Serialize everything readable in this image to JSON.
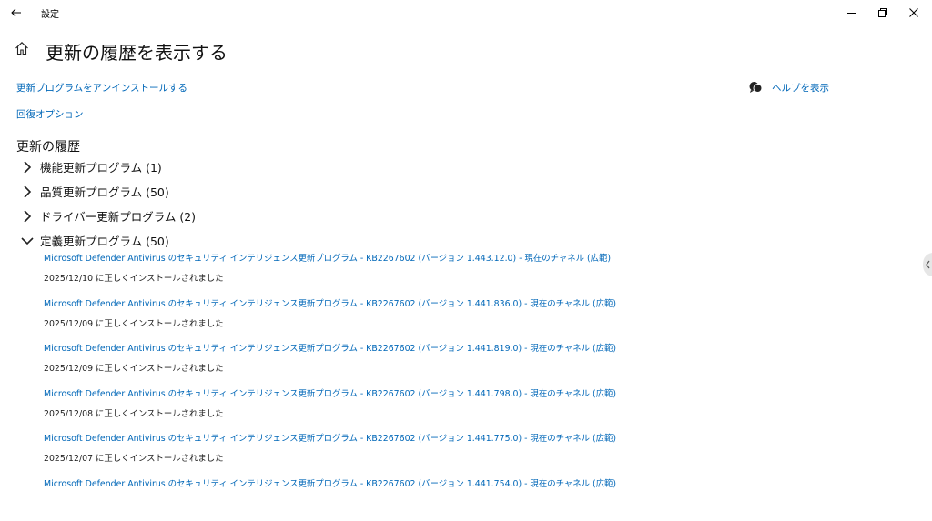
{
  "window": {
    "title": "設定",
    "back_icon": "arrow-left-icon",
    "controls": [
      "minimize-icon",
      "restore-icon",
      "close-icon"
    ]
  },
  "page": {
    "home_icon": "home-icon",
    "title": "更新の履歴を表示する"
  },
  "links": {
    "uninstall": "更新プログラムをアンインストールする",
    "recovery": "回復オプション",
    "help": "ヘルプを表示",
    "help_icon": "chat-help-icon"
  },
  "history": {
    "heading": "更新の履歴",
    "categories": [
      {
        "label": "機能更新プログラム (1)",
        "expanded": false
      },
      {
        "label": "品質更新プログラム (50)",
        "expanded": false
      },
      {
        "label": "ドライバー更新プログラム (2)",
        "expanded": false
      },
      {
        "label": "定義更新プログラム (50)",
        "expanded": true
      }
    ],
    "definition_updates": [
      {
        "title": "Microsoft Defender Antivirus のセキュリティ インテリジェンス更新プログラム - KB2267602 (バージョン 1.443.12.0) - 現在のチャネル (広範)",
        "status": "2025/12/10 に正しくインストールされました"
      },
      {
        "title": "Microsoft Defender Antivirus のセキュリティ インテリジェンス更新プログラム - KB2267602 (バージョン 1.441.836.0) - 現在のチャネル (広範)",
        "status": "2025/12/09 に正しくインストールされました"
      },
      {
        "title": "Microsoft Defender Antivirus のセキュリティ インテリジェンス更新プログラム - KB2267602 (バージョン 1.441.819.0) - 現在のチャネル (広範)",
        "status": "2025/12/09 に正しくインストールされました"
      },
      {
        "title": "Microsoft Defender Antivirus のセキュリティ インテリジェンス更新プログラム - KB2267602 (バージョン 1.441.798.0) - 現在のチャネル (広範)",
        "status": "2025/12/08 に正しくインストールされました"
      },
      {
        "title": "Microsoft Defender Antivirus のセキュリティ インテリジェンス更新プログラム - KB2267602 (バージョン 1.441.775.0) - 現在のチャネル (広範)",
        "status": "2025/12/07 に正しくインストールされました"
      },
      {
        "title": "Microsoft Defender Antivirus のセキュリティ インテリジェンス更新プログラム - KB2267602 (バージョン 1.441.754.0) - 現在のチャネル (広範)",
        "status": ""
      }
    ]
  },
  "colors": {
    "link": "#0067b8",
    "text": "#111111",
    "background": "#ffffff"
  }
}
